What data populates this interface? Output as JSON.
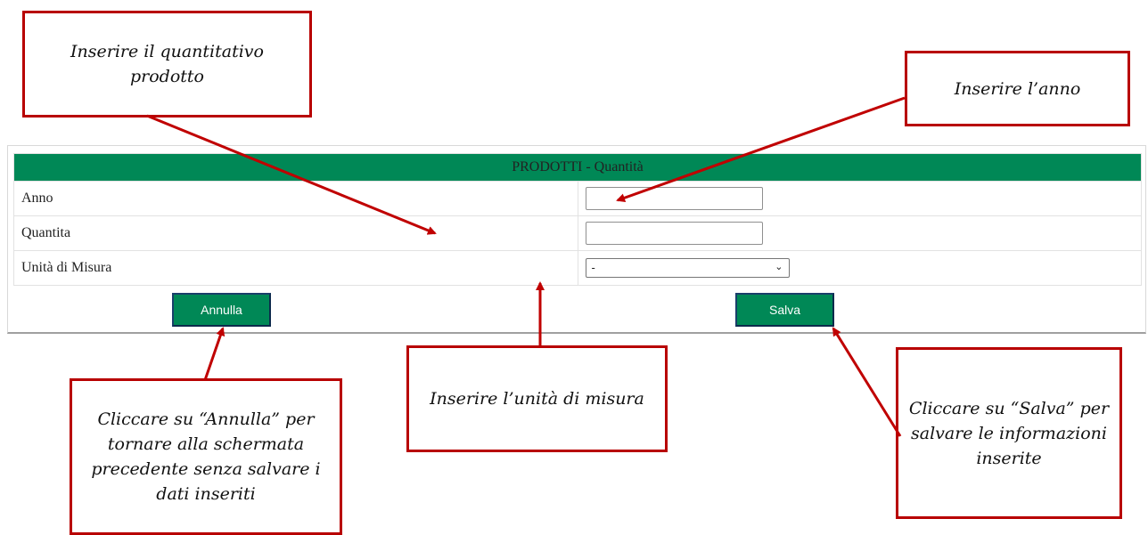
{
  "form": {
    "header": "PRODOTTI - Quantità",
    "rows": [
      {
        "label": "Anno",
        "value": ""
      },
      {
        "label": "Quantita",
        "value": ""
      },
      {
        "label": "Unità di Misura",
        "selected": "-"
      }
    ],
    "buttons": {
      "cancel": "Annulla",
      "save": "Salva"
    }
  },
  "callouts": {
    "quantity": "Inserire il quantitativo prodotto",
    "year": "Inserire l’anno",
    "unit": "Inserire l’unità di misura",
    "cancel": "Cliccare su “Annulla” per tornare alla schermata precedente senza salvare i dati inseriti",
    "save": "Cliccare su “Salva” per salvare le informazioni inserite"
  },
  "colors": {
    "header_green": "#008856",
    "callout_red": "#b80000",
    "arrow_red": "#c00000"
  }
}
